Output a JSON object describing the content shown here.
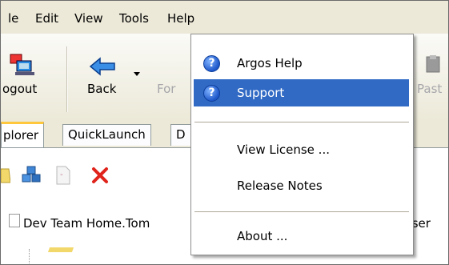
{
  "menubar": {
    "items": [
      "le",
      "Edit",
      "View",
      "Tools",
      "Help"
    ]
  },
  "toolbar": {
    "logout_label": "ogout",
    "back_label": "Back",
    "forward_label": "For",
    "paste_label": "Past"
  },
  "tabs": [
    "plorer",
    "QuickLaunch",
    "D"
  ],
  "address": {
    "path": "Dev Team Home.Tom",
    "user": ".User"
  },
  "help_menu": {
    "argos_help": "Argos Help",
    "support": "Support",
    "view_license": "View License ...",
    "release_notes": "Release Notes",
    "about": "About ..."
  },
  "colors": {
    "selection": "#316ac5",
    "menubar": "#ece9d8",
    "tab_accent": "#ffc83c"
  }
}
